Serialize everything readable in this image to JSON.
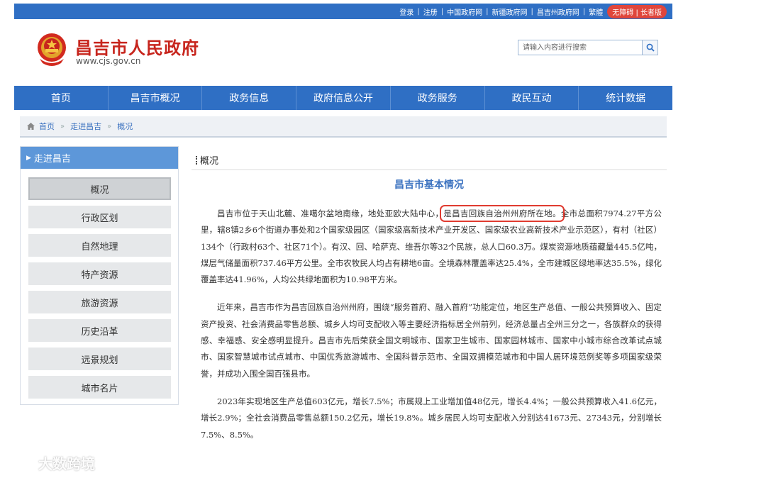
{
  "top_bar": {
    "links": [
      "登录",
      "注册",
      "中国政府网",
      "新疆政府网",
      "昌吉州政府网",
      "繁體"
    ],
    "accessibility_label": "无障碍 | 长者版"
  },
  "header": {
    "site_title": "昌吉市人民政府",
    "site_url": "www.cjs.gov.cn"
  },
  "search": {
    "placeholder": "请输入内容进行搜索",
    "icon": "search-icon"
  },
  "nav": {
    "items": [
      "首页",
      "昌吉市概况",
      "政务信息",
      "政府信息公开",
      "政务服务",
      "政民互动",
      "统计数据"
    ]
  },
  "breadcrumb": {
    "icon": "home-icon",
    "items": [
      "首页",
      "走进昌吉",
      "概况"
    ]
  },
  "sidebar": {
    "title": "走进昌吉",
    "items": [
      "概况",
      "行政区划",
      "自然地理",
      "特产资源",
      "旅游资源",
      "历史沿革",
      "远景规划",
      "城市名片"
    ],
    "active_index": 0
  },
  "main": {
    "section_title": "概况",
    "article_title": "昌吉市基本情况",
    "p1_before": "昌吉市位于天山北麓、准噶尔盆地南缘，地处亚欧大陆中心，",
    "p1_highlight": "是昌吉回族自治州州府所在地。",
    "p1_after": "全市总面积7974.27平方公里，辖8镇2乡6个街道办事处和2个国家级园区（国家级高新技术产业开发区、国家级农业高新技术产业示范区），有村（社区）134个（行政村63个、社区71个）。有汉、回、哈萨克、维吾尔等32个民族，总人口60.3万。煤炭资源地质蕴藏量445.5亿吨，煤层气储量面积737.46平方公里。全市农牧民人均占有耕地6亩。全境森林覆盖率达25.4%，全市建城区绿地率达35.5%，绿化覆盖率达41.96%，人均公共绿地面积为10.98平方米。",
    "p2": "近年来，昌吉市作为昌吉回族自治州州府，围绕“服务首府、融入首府”功能定位，地区生产总值、一般公共预算收入、固定资产投资、社会消费品零售总额、城乡人均可支配收入等主要经济指标居全州前列，经济总量占全州三分之一，各族群众的获得感、幸福感、安全感明显提升。昌吉市先后荣获全国文明城市、国家卫生城市、国家园林城市、国家中小城市综合改革试点城市、国家智慧城市试点城市、中国优秀旅游城市、全国科普示范市、全国双拥模范城市和中国人居环境范例奖等多项国家级荣誉，并成功入围全国百强县市。",
    "p3": "2023年实现地区生产总值603亿元，增长7.5%；市属规上工业增加值48亿元，增长4.4%；一般公共预算收入41.6亿元，增长2.9%；全社会消费品零售总额150.2亿元，增长19.8%。城乡居民人均可支配收入分别达41673元、27343元，分别增长7.5%、8.5%。"
  },
  "watermark": {
    "text": "大数跨境"
  },
  "colors": {
    "primary_blue": "#2f6fc4",
    "title_red": "#c7251d",
    "highlight_red": "#e03b30",
    "sidebar_head": "#5d97d9"
  }
}
